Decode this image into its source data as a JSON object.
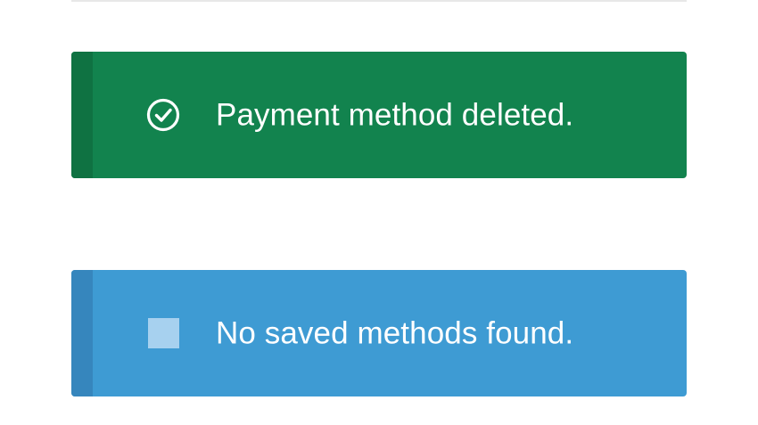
{
  "notices": [
    {
      "type": "success",
      "icon": "check-circle-icon",
      "message": "Payment method deleted.",
      "color": "#12834e",
      "stripe_color": "#0f7242"
    },
    {
      "type": "info",
      "icon": "square-icon",
      "message": "No saved methods found.",
      "color": "#3e9bd3",
      "stripe_color": "#3686bd"
    }
  ]
}
